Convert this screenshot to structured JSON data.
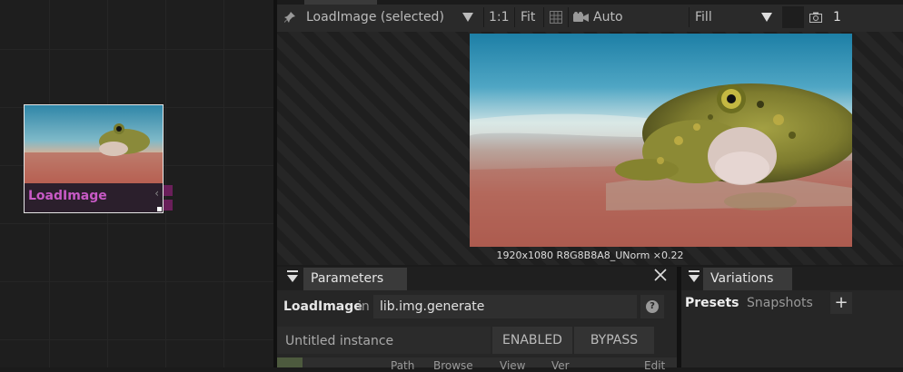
{
  "graph": {
    "node": {
      "title": "LoadImage",
      "collapse_glyph": "‹"
    }
  },
  "viewer": {
    "node_label": "LoadImage (selected)",
    "zoom_one": "1:1",
    "fit": "Fit",
    "auto": "Auto",
    "fill": "Fill",
    "frame": "1",
    "image_info": "1920x1080  R8G8B8A8_UNorm  ×0.22"
  },
  "parameters": {
    "tab_label": "Parameters",
    "node_name": "LoadImage",
    "in_label": "in",
    "library": "lib.img.generate",
    "help": "?",
    "instance_placeholder": "Untitled instance",
    "enabled_label": "ENABLED",
    "bypass_label": "BYPASS",
    "columns": [
      "Path",
      "Browse",
      "View",
      "Ver",
      "Edit"
    ]
  },
  "variations": {
    "tab_label": "Variations",
    "tabs": [
      "Presets",
      "Snapshots"
    ],
    "add": "+"
  },
  "colors": {
    "node_title": "#c85ac6",
    "port": "#6a1f5a",
    "panel_tab": "#3a3a3a"
  }
}
